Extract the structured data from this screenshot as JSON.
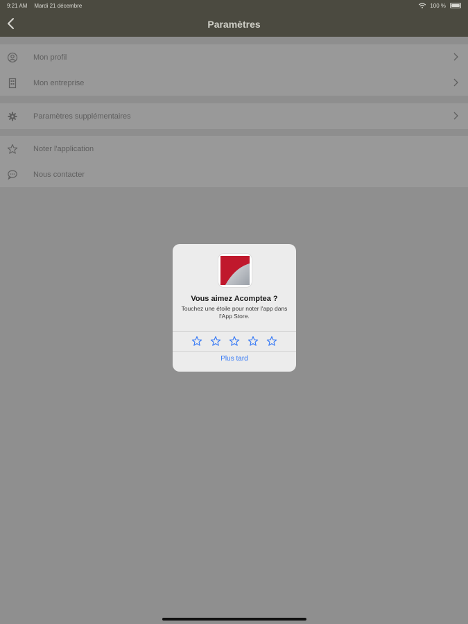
{
  "status_bar": {
    "time": "9:21 AM",
    "date": "Mardi 21 décembre",
    "battery": "100 %"
  },
  "nav": {
    "title": "Paramètres",
    "back_icon": "chevron-left-icon"
  },
  "settings": {
    "group1": [
      {
        "label": "Mon profil",
        "icon": "user-circle-icon"
      },
      {
        "label": "Mon entreprise",
        "icon": "building-icon"
      }
    ],
    "group2": [
      {
        "label": "Paramètres supplémentaires",
        "icon": "gear-icon"
      }
    ],
    "group3": [
      {
        "label": "Noter l'application",
        "icon": "star-icon"
      },
      {
        "label": "Nous contacter",
        "icon": "chat-bubble-icon"
      }
    ]
  },
  "dialog": {
    "title": "Vous aimez Acomptea ?",
    "message": "Touchez une étoile pour noter l'app dans l'App Store.",
    "stars": 5,
    "later_label": "Plus tard"
  },
  "colors": {
    "navbar": "#4b4a40",
    "overlay_background": "#8f8f8f",
    "accent_blue": "#3478f6",
    "brand_red": "#c0182c"
  }
}
